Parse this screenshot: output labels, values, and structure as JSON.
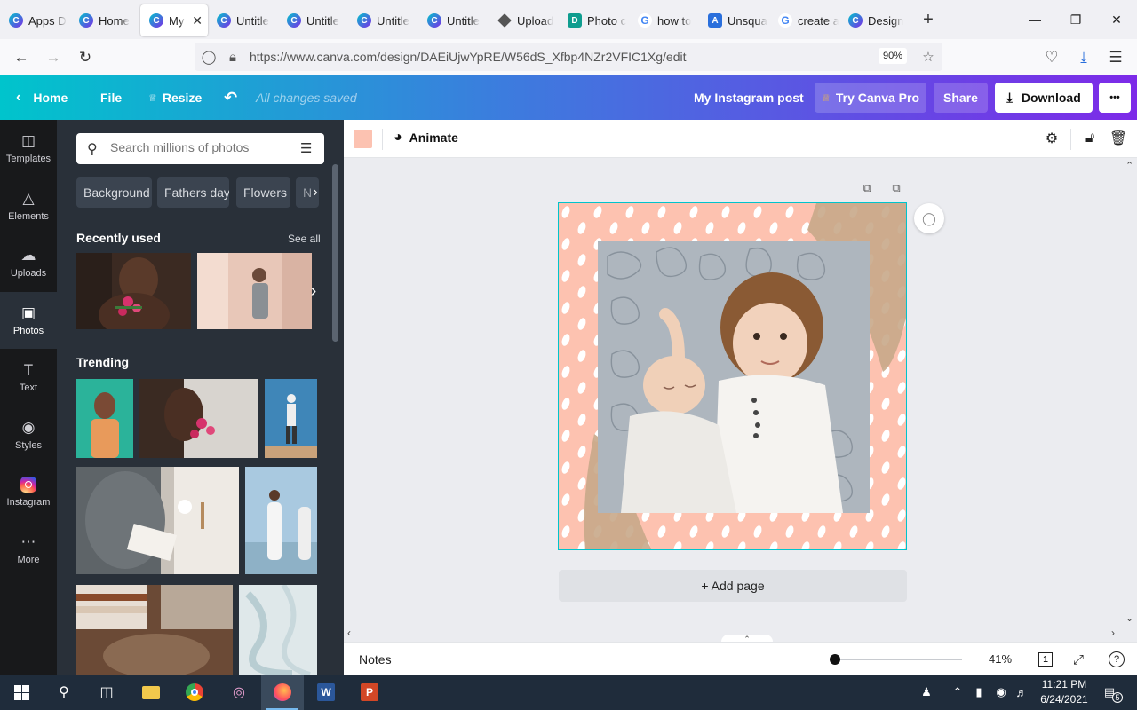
{
  "browser": {
    "tabs": [
      {
        "label": "Apps D",
        "favicon": "canva"
      },
      {
        "label": "Home",
        "favicon": "canva"
      },
      {
        "label": "My I",
        "favicon": "canva",
        "active": true
      },
      {
        "label": "Untitle",
        "favicon": "canva"
      },
      {
        "label": "Untitle",
        "favicon": "canva"
      },
      {
        "label": "Untitle",
        "favicon": "canva"
      },
      {
        "label": "Untitle",
        "favicon": "canva"
      },
      {
        "label": "Upload",
        "favicon": "stack"
      },
      {
        "label": "Photo c",
        "favicon": "d"
      },
      {
        "label": "how to",
        "favicon": "google"
      },
      {
        "label": "Unsqua",
        "favicon": "appstore"
      },
      {
        "label": "create a",
        "favicon": "google"
      },
      {
        "label": "Design",
        "favicon": "canva"
      }
    ],
    "new_tab_icon": "plus-icon",
    "url": "https://www.canva.com/design/DAEiUjwYpRE/W56dS_Xfbp4NZr2VFIC1Xg/edit",
    "zoom": "90%"
  },
  "canva_header": {
    "home": "Home",
    "file": "File",
    "resize": "Resize",
    "saved_status": "All changes saved",
    "design_title": "My Instagram post",
    "try_pro": "Try Canva Pro",
    "share": "Share",
    "download": "Download",
    "more": "•••"
  },
  "rail": [
    {
      "label": "Templates",
      "icon": "templates-icon"
    },
    {
      "label": "Elements",
      "icon": "elements-icon"
    },
    {
      "label": "Uploads",
      "icon": "upload-cloud-icon"
    },
    {
      "label": "Photos",
      "icon": "photos-icon",
      "active": true
    },
    {
      "label": "Text",
      "icon": "text-icon"
    },
    {
      "label": "Styles",
      "icon": "palette-icon"
    },
    {
      "label": "Instagram",
      "icon": "instagram-icon"
    },
    {
      "label": "More",
      "icon": "more-dots-icon"
    }
  ],
  "photos_panel": {
    "search_placeholder": "Search millions of photos",
    "chips": [
      "Background",
      "Fathers day",
      "Flowers",
      "N"
    ],
    "recently_used": "Recently used",
    "see_all": "See all",
    "trending": "Trending"
  },
  "editor": {
    "color_swatch": "#fcc2b1",
    "animate": "Animate",
    "add_page": "+ Add page",
    "notes": "Notes",
    "zoom_pct": "41%",
    "page_number": "1"
  },
  "taskbar": {
    "time": "11:21 PM",
    "date": "6/24/2021",
    "notification_count": "5"
  },
  "colors": {
    "canva_teal": "#00c4cc",
    "canva_purple": "#7d2ae8",
    "pro_button": "#8b3dff",
    "artboard_pink": "#fdc2b0"
  }
}
